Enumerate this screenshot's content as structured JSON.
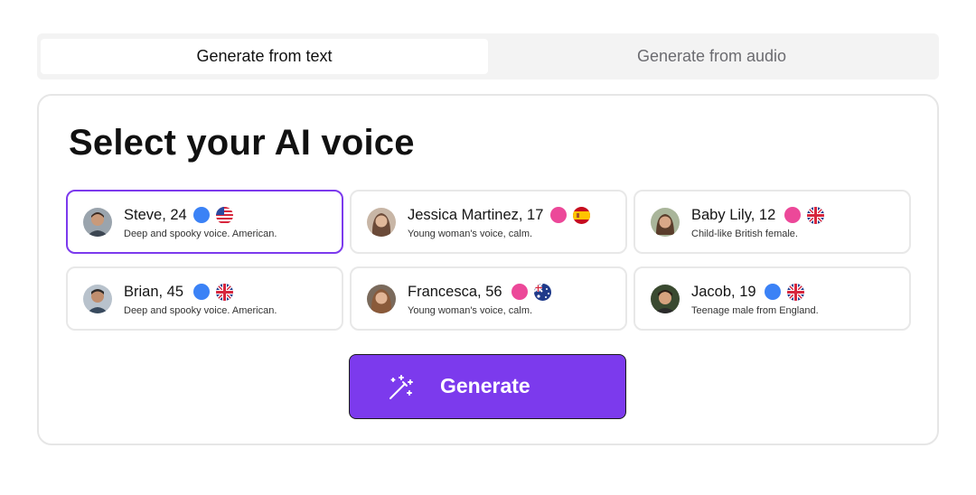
{
  "tabs": [
    {
      "label": "Generate from text",
      "active": true
    },
    {
      "label": "Generate from audio",
      "active": false
    }
  ],
  "title": "Select your AI voice",
  "voices": [
    {
      "name": "Steve, 24",
      "desc": "Deep and spooky voice. American.",
      "dot_color": "#3b82f6",
      "flag": "us-flag-icon",
      "selected": true
    },
    {
      "name": "Jessica Martinez, 17",
      "desc": "Young woman's voice, calm.",
      "dot_color": "#ec4899",
      "flag": "es-flag-icon",
      "selected": false
    },
    {
      "name": "Baby Lily, 12",
      "desc": "Child-like British female.",
      "dot_color": "#ec4899",
      "flag": "uk-flag-icon",
      "selected": false
    },
    {
      "name": "Brian, 45",
      "desc": "Deep and spooky voice. American.",
      "dot_color": "#3b82f6",
      "flag": "uk-flag-icon",
      "selected": false
    },
    {
      "name": "Francesca, 56",
      "desc": "Young woman's voice, calm.",
      "dot_color": "#ec4899",
      "flag": "au-flag-icon",
      "selected": false
    },
    {
      "name": "Jacob, 19",
      "desc": "Teenage male from England.",
      "dot_color": "#3b82f6",
      "flag": "uk-flag-icon",
      "selected": false
    }
  ],
  "generate_label": "Generate",
  "colors": {
    "accent": "#7c3aed",
    "male_dot": "#3b82f6",
    "female_dot": "#ec4899"
  }
}
